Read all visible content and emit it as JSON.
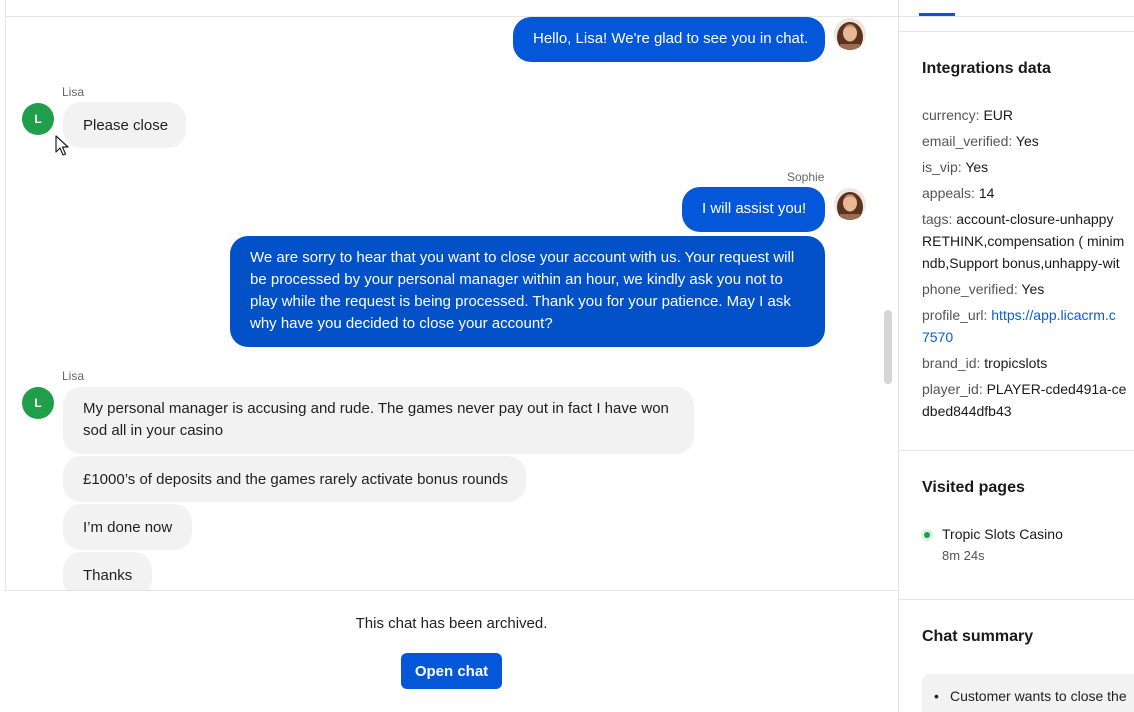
{
  "messages": [
    {
      "text": "Hello, Lisa! We're glad to see you in chat."
    },
    {
      "sender": "Lisa",
      "text": "Please close"
    },
    {
      "sender": "Sophie",
      "text": "I will assist you!"
    },
    {
      "text": "We are sorry to hear that you want to close your account with us. Your request will be processed by your personal manager within an hour, we kindly ask you not to play while the request is being processed. Thank you for your patience. May I ask why have you decided to close your account?"
    },
    {
      "sender": "Lisa",
      "text": "My personal manager is accusing and rude. The games never pay out in fact I have won sod all in your casino"
    },
    {
      "text": "£1000’s of deposits and the games rarely activate bonus rounds"
    },
    {
      "text": "I’m done now"
    },
    {
      "text": "Thanks"
    }
  ],
  "customer_avatar_initial": "L",
  "footer": {
    "note": "This chat has been archived.",
    "button": "Open chat"
  },
  "integrations": {
    "title": "Integrations data",
    "fields": [
      {
        "key": "currency:",
        "value": "EUR"
      },
      {
        "key": "email_verified:",
        "value": "Yes"
      },
      {
        "key": "is_vip:",
        "value": "Yes"
      },
      {
        "key": "appeals:",
        "value": "14"
      },
      {
        "key": "tags:",
        "lines": [
          "account-closure-unhappy",
          "RETHINK,compensation ( minim",
          "ndb,Support bonus,unhappy-wit"
        ]
      },
      {
        "key": "phone_verified:",
        "value": "Yes"
      },
      {
        "key": "profile_url:",
        "lines": [
          "https://app.licacrm.c",
          "7570"
        ]
      },
      {
        "key": "brand_id:",
        "value": "tropicslots"
      },
      {
        "key": "player_id:",
        "lines": [
          "PLAYER-cded491a-ce",
          "dbed844dfb43"
        ]
      }
    ]
  },
  "visited": {
    "title": "Visited pages",
    "page": "Tropic Slots Casino",
    "duration": "8m 24s"
  },
  "summary": {
    "title": "Chat summary",
    "item": "Customer wants to close the"
  },
  "colors": {
    "agent_bubble": "#0457d9",
    "customer_bubble": "#f2f2f2",
    "online_green": "#1f9f4a"
  }
}
